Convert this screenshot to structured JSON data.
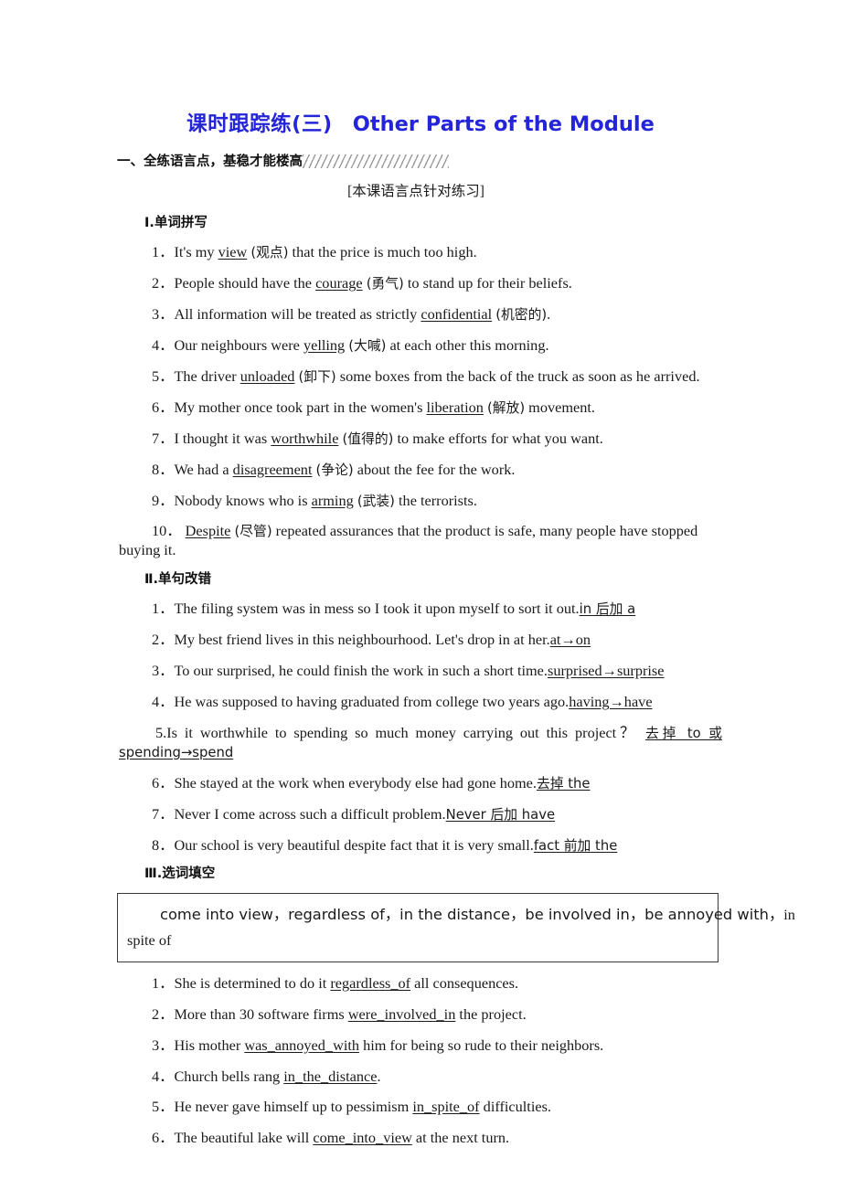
{
  "title": {
    "chinese": "课时跟踪练(三)",
    "english": "Other Parts of the Module",
    "color": "#2424d8"
  },
  "banner": {
    "label": "一、全练语言点，基稳才能楼高"
  },
  "subnote": "[本课语言点针对练习]",
  "sections": [
    {
      "heading": "Ⅰ.单词拼写",
      "items": [
        {
          "num": "1．",
          "pre": "It's my ",
          "answer": "view",
          "cn": "(观点)",
          "post": " that the price is much too high."
        },
        {
          "num": "2．",
          "pre": "People should have the ",
          "answer": "courage",
          "cn": "(勇气)",
          "post": " to stand up for their beliefs."
        },
        {
          "num": "3．",
          "pre": "All information will be treated as strictly ",
          "answer": "confidential",
          "cn": "(机密的)",
          "post": "."
        },
        {
          "num": "4．",
          "pre": "Our neighbours were ",
          "answer": "yelling",
          "cn": "(大喊)",
          "post": " at each other this morning."
        },
        {
          "num": "5．",
          "pre": "The driver ",
          "answer": "unloaded",
          "cn": "(卸下)",
          "post": " some boxes from the back of the truck as soon as he arrived."
        },
        {
          "num": "6．",
          "pre": "My mother once took part in the women's ",
          "answer": "liberation",
          "cn": "(解放)",
          "post": " movement."
        },
        {
          "num": "7．",
          "pre": "I thought it was ",
          "answer": "worthwhile",
          "cn": "(值得的)",
          "post": " to make efforts for what you want."
        },
        {
          "num": "8．",
          "pre": "We had a ",
          "answer": "disagreement",
          "cn": "(争论)",
          "post": " about the fee for the work."
        },
        {
          "num": "9．",
          "pre": "Nobody knows who is ",
          "answer": "arming",
          "cn": "(武装)",
          "post": " the terrorists."
        },
        {
          "num": "10．",
          "pre": "",
          "answer": "Despite",
          "cn": "(尽管)",
          "post": " repeated assurances that the product is safe, many people have stopped buying it."
        }
      ]
    },
    {
      "heading": "Ⅱ.单句改错",
      "items": [
        {
          "num": "1．",
          "sentence": "The filing system was in mess so I took it upon myself to sort it out.",
          "answer": "in 后加 a"
        },
        {
          "num": "2．",
          "sentence": "My best friend lives in this neighbourhood. Let's drop in at her.",
          "answer": "at→on"
        },
        {
          "num": "3．",
          "sentence": "To our surprised, he could finish the work in such a short time.",
          "answer": "surprised→surprise"
        },
        {
          "num": "4．",
          "sentence": "He was supposed to having graduated from college two years ago.",
          "answer": "having→have"
        },
        {
          "num": "5.",
          "sentence": "Is it worthwhile to spending so much money carrying out this project？",
          "answer": "去掉 to 或 spending→spend"
        },
        {
          "num": "6．",
          "sentence": "She stayed at the work when everybody else had gone home.",
          "answer": "去掉 the"
        },
        {
          "num": "7．",
          "sentence": "Never I come across such a difficult problem.",
          "answer": "Never 后加 have"
        },
        {
          "num": "8．",
          "sentence": "Our school is very beautiful despite fact that it is very small.",
          "answer": "fact 前加 the"
        }
      ]
    },
    {
      "heading": "Ⅲ.选词填空",
      "wordbank": {
        "line1": [
          "come into view，",
          "regardless of，",
          "in the distance，",
          "be involved in，",
          "be annoyed with，",
          "in"
        ],
        "line2": "spite of"
      },
      "items": [
        {
          "num": "1．",
          "pre": "She is determined to do it ",
          "answer": "regardless_of",
          "post": " all consequences."
        },
        {
          "num": "2．",
          "pre": "More than 30 software firms ",
          "answer": "were_involved_in",
          "post": " the project."
        },
        {
          "num": "3．",
          "pre": "His mother ",
          "answer": "was_annoyed_with",
          "post": " him for being so rude to their neighbors."
        },
        {
          "num": "4．",
          "pre": "Church bells rang ",
          "answer": "in_the_distance",
          "post": "."
        },
        {
          "num": "5．",
          "pre": "He never gave himself up to pessimism ",
          "answer": "in_spite_of",
          "post": " difficulties."
        },
        {
          "num": "6．",
          "pre": "The beautiful lake will ",
          "answer": "come_into_view",
          "post": " at the next turn."
        }
      ]
    }
  ]
}
